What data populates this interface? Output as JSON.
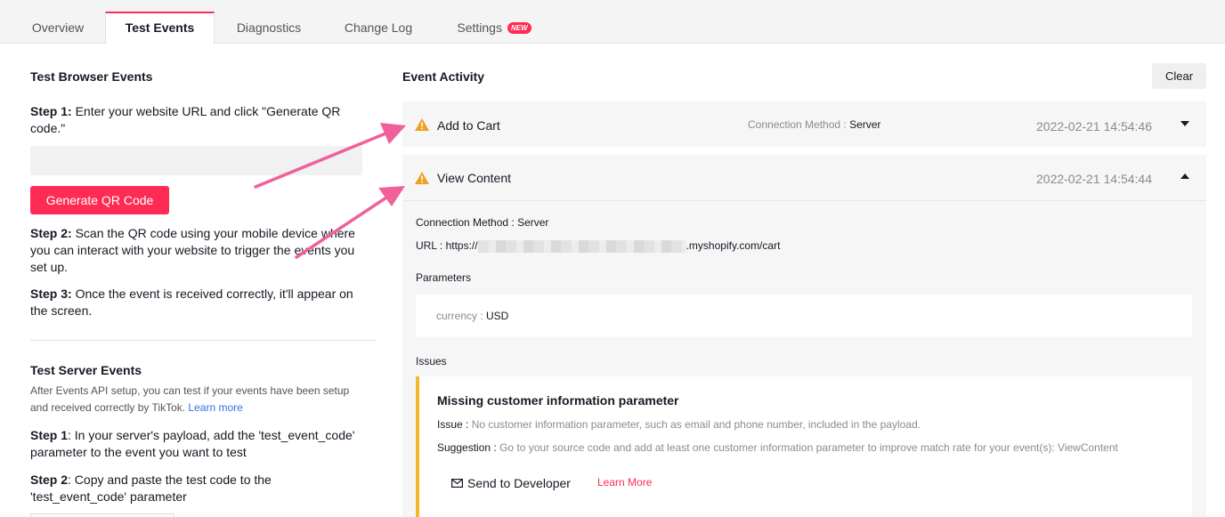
{
  "tabs": [
    {
      "label": "Overview"
    },
    {
      "label": "Test Events"
    },
    {
      "label": "Diagnostics"
    },
    {
      "label": "Change Log"
    },
    {
      "label": "Settings",
      "badge": "NEW"
    }
  ],
  "browser": {
    "title": "Test Browser Events",
    "step1_label": "Step 1:",
    "step1_text": " Enter your website URL and click \"Generate QR code.\"",
    "url_value": "",
    "generate_button": "Generate QR Code",
    "step2_label": "Step 2:",
    "step2_text": " Scan the QR code using your mobile device where you can interact with your website to trigger the events you set up.",
    "step3_label": "Step 3:",
    "step3_text": " Once the event is received correctly, it'll appear on the screen."
  },
  "server": {
    "title": "Test Server Events",
    "description": "After Events API setup, you can test if your events have been setup and received correctly by TikTok.",
    "learn_more": "Learn more",
    "step1_label": "Step 1",
    "step1_text": ": In your server's payload, add the 'test_event_code' parameter to the event you want to test",
    "step2_label": "Step 2",
    "step2_text": ": Copy and paste the test code to the 'test_event_code' parameter"
  },
  "activity": {
    "title": "Event Activity",
    "clear_button": "Clear",
    "events": [
      {
        "name": "Add to Cart",
        "connection_label": "Connection Method : ",
        "connection_value": "Server",
        "timestamp": "2022-02-21 14:54:46"
      },
      {
        "name": "View Content",
        "timestamp": "2022-02-21 14:54:44"
      }
    ],
    "detail": {
      "connection_label": "Connection Method : ",
      "connection_value": "Server",
      "url_label": "URL : ",
      "url_prefix": "https://",
      "url_suffix": ".myshopify.com/cart",
      "parameters_heading": "Parameters",
      "param_key": "currency : ",
      "param_value": "USD",
      "issues_heading": "Issues",
      "issue_title": "Missing customer information parameter",
      "issue_label": "Issue : ",
      "issue_text": "No customer information parameter, such as email and phone number, included in the payload.",
      "suggestion_label": "Suggestion : ",
      "suggestion_text": "Go to your source code and add at least one customer information parameter to improve match rate for your event(s): ViewContent",
      "send_button": "Send to Developer",
      "learn_more": "Learn More"
    }
  },
  "colors": {
    "accent": "#fe2c55",
    "warning": "#f5b72a",
    "annotation_arrow": "#f0609a",
    "link": "#2f74e0"
  },
  "icons": [
    "warning-icon",
    "chevron-down-icon",
    "chevron-up-icon",
    "mail-icon"
  ]
}
